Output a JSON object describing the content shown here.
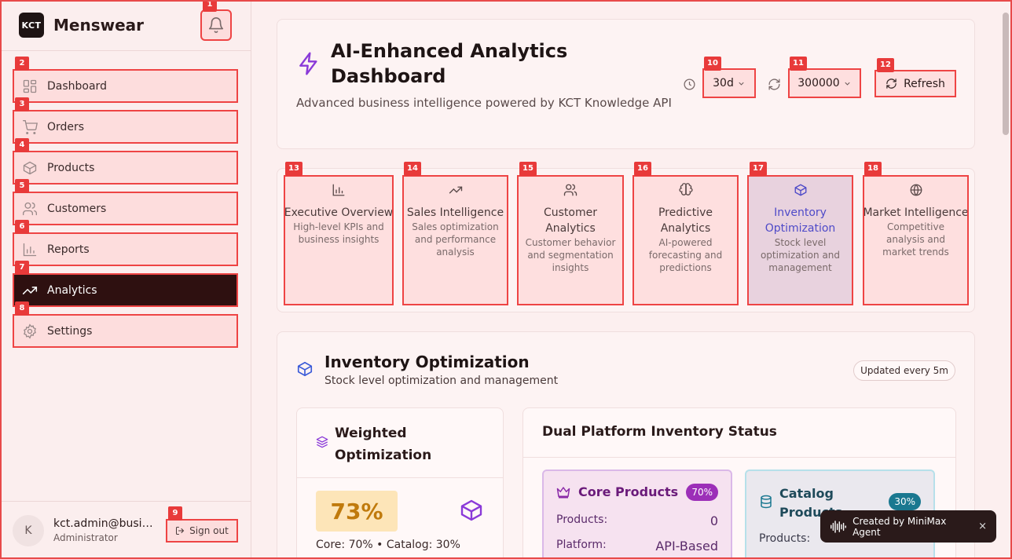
{
  "sidebar": {
    "brand_logo": "KCT",
    "brand_name": "Menswear",
    "items": [
      {
        "label": "Dashboard",
        "icon": "grid-icon"
      },
      {
        "label": "Orders",
        "icon": "cart-icon"
      },
      {
        "label": "Products",
        "icon": "package-icon"
      },
      {
        "label": "Customers",
        "icon": "users-icon"
      },
      {
        "label": "Reports",
        "icon": "bar-chart-icon"
      },
      {
        "label": "Analytics",
        "icon": "trending-up-icon",
        "active": true
      },
      {
        "label": "Settings",
        "icon": "gear-icon"
      }
    ],
    "user": {
      "initial": "K",
      "email": "kct.admin@business",
      "role": "Administrator"
    },
    "signout_label": "Sign out"
  },
  "badges": [
    "1",
    "2",
    "3",
    "4",
    "5",
    "6",
    "7",
    "8",
    "9",
    "10",
    "11",
    "12",
    "13",
    "14",
    "15",
    "16",
    "17",
    "18"
  ],
  "header": {
    "title": "AI-Enhanced Analytics Dashboard",
    "subtitle": "Advanced business intelligence powered by KCT Knowledge API",
    "period": "30d",
    "interval": "300000",
    "refresh_label": "Refresh"
  },
  "tabs": [
    {
      "title": "Executive Overview",
      "desc": "High-level KPIs and business insights",
      "icon": "bar-chart-icon"
    },
    {
      "title": "Sales Intelligence",
      "desc": "Sales optimization and performance analysis",
      "icon": "trending-up-icon"
    },
    {
      "title": "Customer Analytics",
      "desc": "Customer behavior and segmentation insights",
      "icon": "users-icon"
    },
    {
      "title": "Predictive Analytics",
      "desc": "AI-powered forecasting and predictions",
      "icon": "brain-icon"
    },
    {
      "title": "Inventory Optimization",
      "desc": "Stock level optimization and management",
      "icon": "package-icon",
      "selected": true
    },
    {
      "title": "Market Intelligence",
      "desc": "Competitive analysis and market trends",
      "icon": "globe-icon"
    }
  ],
  "inventory": {
    "title": "Inventory Optimization",
    "subtitle": "Stock level optimization and management",
    "updated": "Updated every 5m",
    "weighted": {
      "title": "Weighted Optimization",
      "percent": "73%",
      "split": "Core: 70% • Catalog: 30%"
    },
    "dual": {
      "title": "Dual Platform Inventory Status",
      "core": {
        "title": "Core Products",
        "pill": "70%",
        "products_label": "Products:",
        "products_value": "0",
        "platform_label": "Platform:",
        "platform_value": "API-Based"
      },
      "catalog": {
        "title": "Catalog Products",
        "pill": "30%",
        "products_label": "Products:"
      }
    }
  },
  "toast": {
    "text": "Created by MiniMax Agent",
    "close": "×"
  },
  "colors": {
    "accent_red": "#ee4444",
    "active_nav": "#2e1010",
    "selected_tab_text": "#4e4ac8",
    "percent_bg": "#fde5b8",
    "core_pill": "#9c2fb8",
    "catalog_pill": "#1a7890"
  }
}
